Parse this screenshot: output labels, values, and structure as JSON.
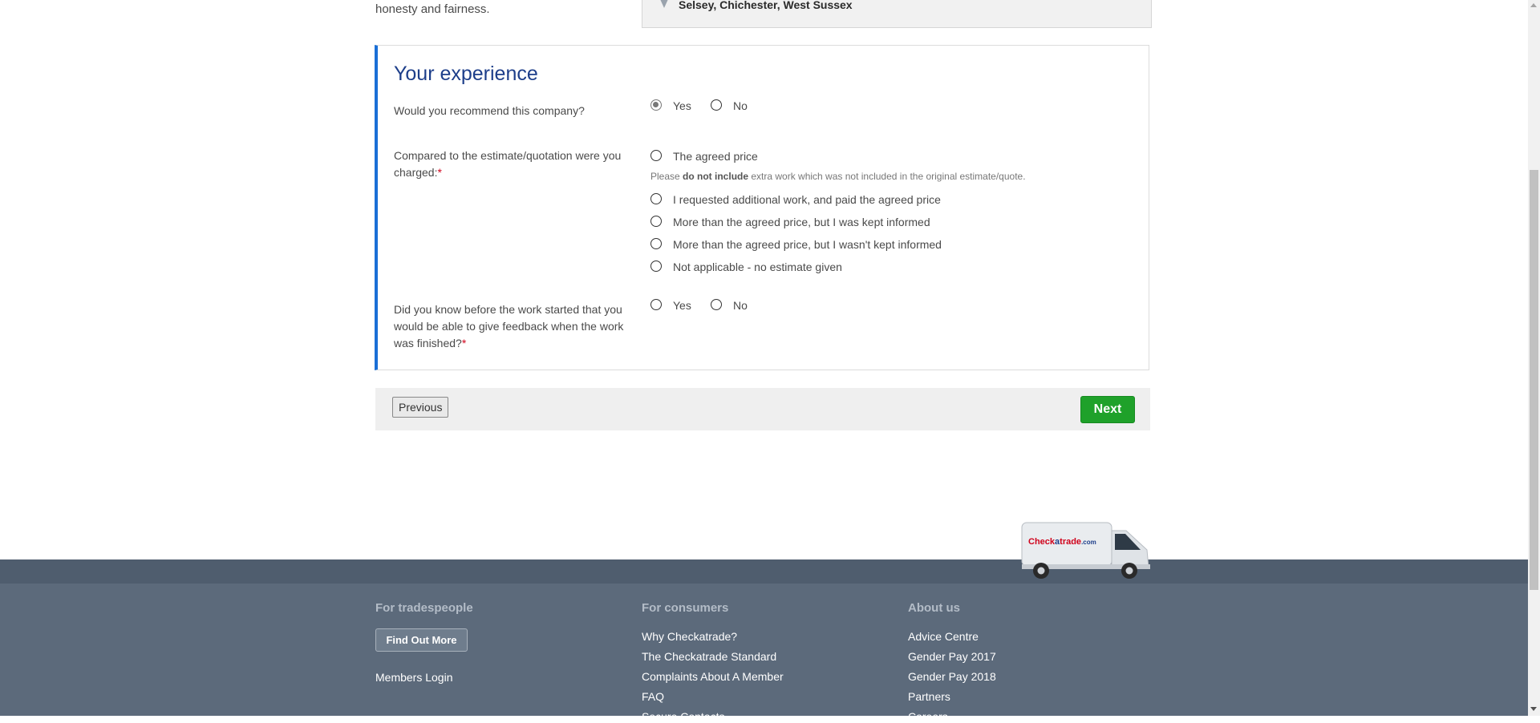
{
  "top": {
    "text": "honesty and fairness.",
    "location": "Selsey, Chichester, West Sussex"
  },
  "experience": {
    "title": "Your experience",
    "q1": {
      "label": "Would you recommend this company?",
      "yes": "Yes",
      "no": "No",
      "selected": "Yes"
    },
    "q2": {
      "label": "Compared to the estimate/quotation were you charged:",
      "required": "*",
      "options": [
        "The agreed price",
        "I requested additional work, and paid the agreed price",
        "More than the agreed price, but I was kept informed",
        "More than the agreed price, but I wasn't kept informed",
        "Not applicable - no estimate given"
      ],
      "hint_pre": "Please ",
      "hint_bold": "do not include",
      "hint_post": " extra work which was not included in the original estimate/quote."
    },
    "q3": {
      "label": "Did you know before the work started that you would be able to give feedback when the work was finished?",
      "required": "*",
      "yes": "Yes",
      "no": "No"
    }
  },
  "nav": {
    "previous": "Previous",
    "next": "Next"
  },
  "van": {
    "brand_check": "Check",
    "brand_a": "a",
    "brand_trade": "trade",
    "brand_com": ".com"
  },
  "footer": {
    "tradespeople": {
      "heading": "For tradespeople",
      "button": "Find Out More",
      "links": [
        "Members Login"
      ]
    },
    "consumers": {
      "heading": "For consumers",
      "links": [
        "Why Checkatrade?",
        "The Checkatrade Standard",
        "Complaints About A Member",
        "FAQ",
        "Secure Contacts"
      ]
    },
    "about": {
      "heading": "About us",
      "links": [
        "Advice Centre",
        "Gender Pay 2017",
        "Gender Pay 2018",
        "Partners",
        "Careers"
      ]
    }
  },
  "colors": {
    "accent": "#1a6fd6",
    "heading": "#1d3e8a",
    "next_button": "#1fa12a",
    "footer": "#5c6a7b",
    "required": "#d0021b"
  }
}
